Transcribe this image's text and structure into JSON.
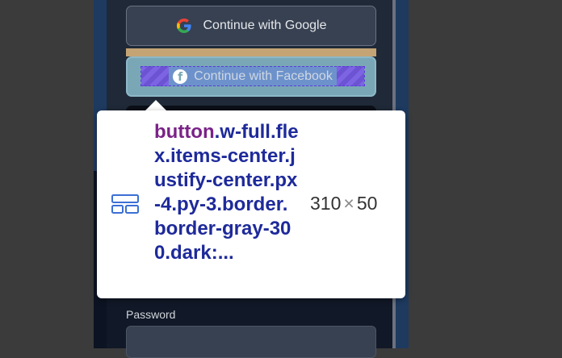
{
  "buttons": {
    "google_label": "Continue with Google",
    "facebook_label_a": "Continue with ",
    "facebook_label_b": "Facebook"
  },
  "form": {
    "password_label": "Password"
  },
  "inspector": {
    "tag": "button",
    "classes": ".w-full.flex.items-center.justify-center.px-4.py-3.border.border-gray-300.dark:...",
    "width": "310",
    "times": "×",
    "height": "50"
  },
  "icons": {
    "google": "google-logo-icon",
    "facebook": "facebook-logo-icon",
    "inspector": "element-grid-icon"
  },
  "colors": {
    "highlight_padding": "#7c5ce8",
    "highlight_content": "#7aa7b5",
    "highlight_margin": "#c4a474",
    "selector_tag": "#7a2287",
    "selector_class": "#1e2a9a"
  }
}
